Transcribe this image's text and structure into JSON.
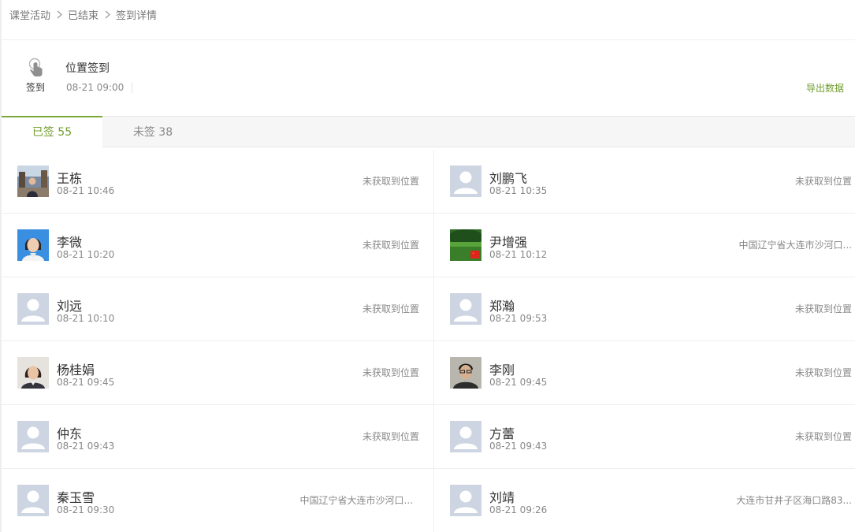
{
  "breadcrumb": {
    "items": [
      "课堂活动",
      "已结束",
      "签到详情"
    ]
  },
  "activity": {
    "icon": "hand-tap-icon",
    "icon_label": "签到",
    "title": "位置签到",
    "time": "08-21 09:00",
    "export_label": "导出数据"
  },
  "tabs": [
    {
      "label": "已签 55",
      "active": true
    },
    {
      "label": "未签 38",
      "active": false
    }
  ],
  "colors": {
    "accent": "#6f9d2c",
    "placeholder_avatar": "#cdd4e2"
  },
  "students": [
    {
      "name": "王栋",
      "time": "08-21 10:46",
      "location": "未获取到位置",
      "avatar": "photo-outdoor"
    },
    {
      "name": "刘鹏飞",
      "time": "08-21 10:35",
      "location": "未获取到位置",
      "avatar": "placeholder"
    },
    {
      "name": "李微",
      "time": "08-21 10:20",
      "location": "未获取到位置",
      "avatar": "photo-portrait-blue"
    },
    {
      "name": "尹增强",
      "time": "08-21 10:12",
      "location": "中国辽宁省大连市沙河口...",
      "avatar": "photo-green-flag"
    },
    {
      "name": "刘远",
      "time": "08-21 10:10",
      "location": "未获取到位置",
      "avatar": "placeholder"
    },
    {
      "name": "郑瀚",
      "time": "08-21 09:53",
      "location": "未获取到位置",
      "avatar": "placeholder"
    },
    {
      "name": "杨桂娟",
      "time": "08-21 09:45",
      "location": "未获取到位置",
      "avatar": "photo-portrait-woman"
    },
    {
      "name": "李刚",
      "time": "08-21 09:45",
      "location": "未获取到位置",
      "avatar": "photo-portrait-man"
    },
    {
      "name": "仲东",
      "time": "08-21 09:43",
      "location": "未获取到位置",
      "avatar": "placeholder"
    },
    {
      "name": "方蕾",
      "time": "08-21 09:43",
      "location": "未获取到位置",
      "avatar": "placeholder"
    },
    {
      "name": "秦玉雪",
      "time": "08-21 09:30",
      "location": "中国辽宁省大连市沙河口...",
      "avatar": "placeholder"
    },
    {
      "name": "刘靖",
      "time": "08-21 09:26",
      "location": "大连市甘井子区海口路83...",
      "avatar": "placeholder"
    }
  ]
}
